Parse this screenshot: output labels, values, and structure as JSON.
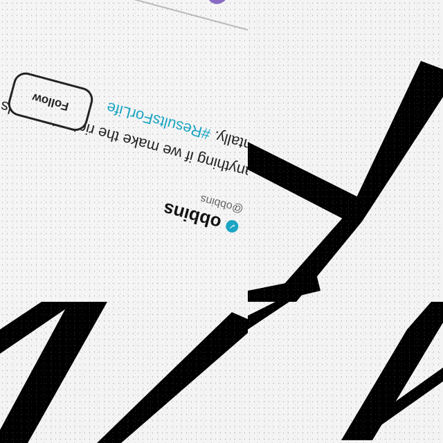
{
  "tweet": {
    "display_name": "obbins",
    "handle": "@obbins",
    "text_line_1": "anything if we make the right demands",
    "text_line_2": "entally.",
    "hashtag": "#ResultsForLife",
    "follow_label": "Follow"
  },
  "colors": {
    "hashtag": "#1aa6c4",
    "emoji_1": "#8a6cc7",
    "emoji_2": "#e59a3a"
  }
}
